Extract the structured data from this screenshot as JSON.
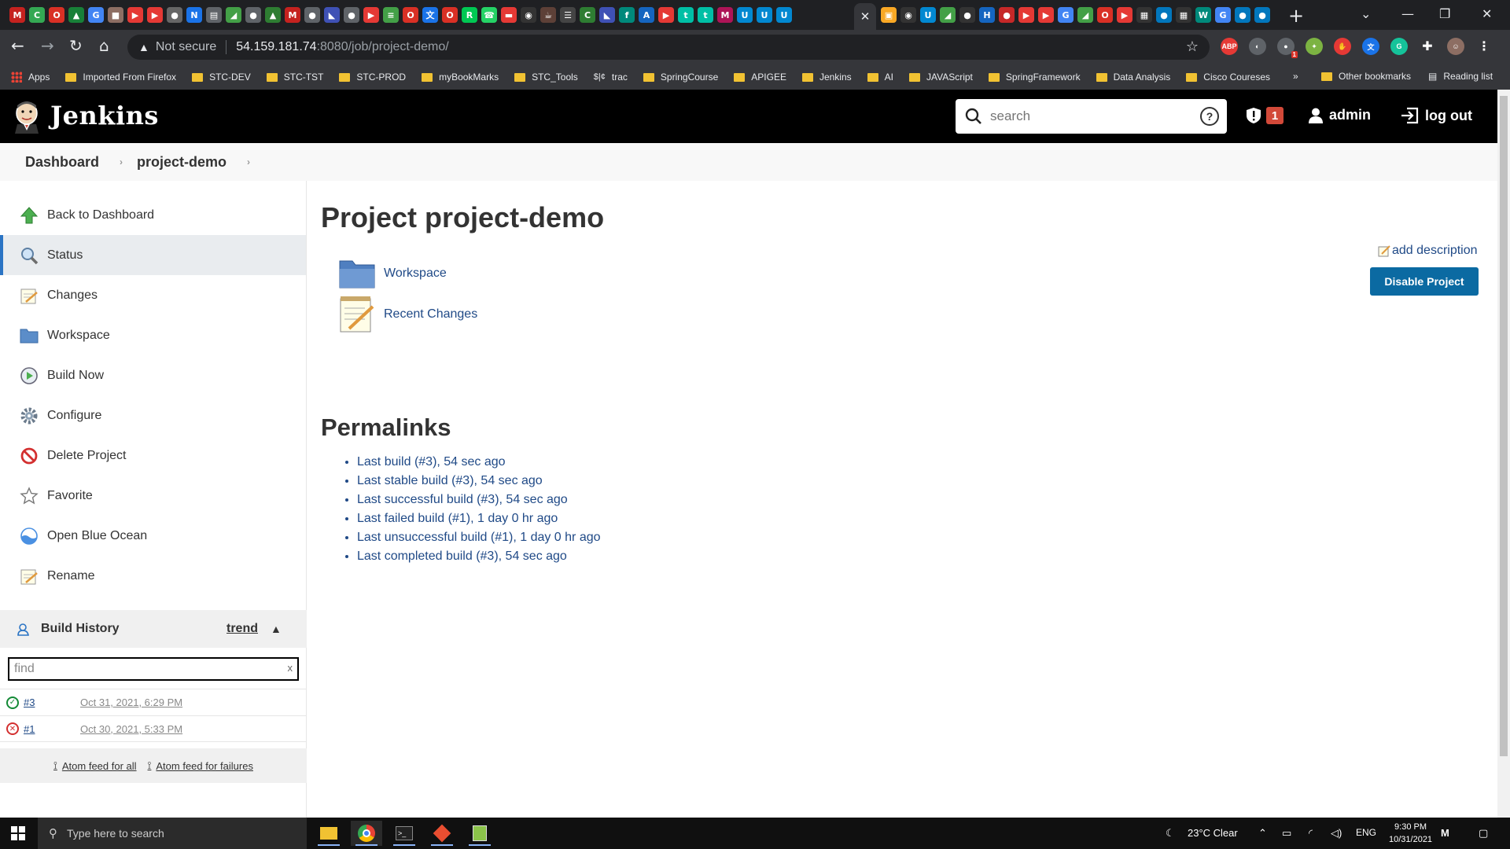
{
  "browser": {
    "active_tab_icon": "close-icon",
    "address": {
      "not_secure": "Not secure",
      "host": "54.159.181.74",
      "path": ":8080/job/project-demo/"
    },
    "bookmarks": [
      "Apps",
      "Imported From Firefox",
      "STC-DEV",
      "STC-TST",
      "STC-PROD",
      "myBookMarks",
      "STC_Tools",
      "trac",
      "SpringCourse",
      "APIGEE",
      "Jenkins",
      "AI",
      "JAVAScript",
      "SpringFramework",
      "Data Analysis",
      "Cisco Coureses"
    ],
    "bookmarks_more": "»",
    "other_bookmarks": "Other bookmarks",
    "reading_list": "Reading list",
    "extensions": {
      "abp": "ABP",
      "badge": "1"
    }
  },
  "jenkins": {
    "title": "Jenkins",
    "search_placeholder": "search",
    "alert_count": "1",
    "user": "admin",
    "logout": "log out",
    "breadcrumb": [
      "Dashboard",
      "project-demo"
    ],
    "tasks": [
      "Back to Dashboard",
      "Status",
      "Changes",
      "Workspace",
      "Build Now",
      "Configure",
      "Delete Project",
      "Favorite",
      "Open Blue Ocean",
      "Rename"
    ],
    "build_history": {
      "title": "Build History",
      "trend": "trend",
      "find_placeholder": "find",
      "find_clear": "x",
      "builds": [
        {
          "number": "#3",
          "date": "Oct 31, 2021, 6:29 PM",
          "status": "success"
        },
        {
          "number": "#1",
          "date": "Oct 30, 2021, 5:33 PM",
          "status": "failed"
        }
      ],
      "feed_all": "Atom feed for all",
      "feed_failures": "Atom feed for failures"
    },
    "main": {
      "title": "Project project-demo",
      "add_description": "add description",
      "disable_button": "Disable Project",
      "workspace_link": "Workspace",
      "recent_changes_link": "Recent Changes",
      "permalinks_title": "Permalinks",
      "permalinks": [
        "Last build (#3), 54 sec ago",
        "Last stable build (#3), 54 sec ago",
        "Last successful build (#3), 54 sec ago",
        "Last failed build (#1), 1 day 0 hr ago",
        "Last unsuccessful build (#1), 1 day 0 hr ago",
        "Last completed build (#3), 54 sec ago"
      ]
    }
  },
  "taskbar": {
    "search_placeholder": "Type here to search",
    "weather": "23°C  Clear",
    "lang": "ENG",
    "time": "9:30 PM",
    "date": "10/31/2021"
  },
  "colors": {
    "jenkins_header": "#000000",
    "link": "#204a87",
    "button": "#0b6aa2",
    "badge": "#d24939"
  }
}
